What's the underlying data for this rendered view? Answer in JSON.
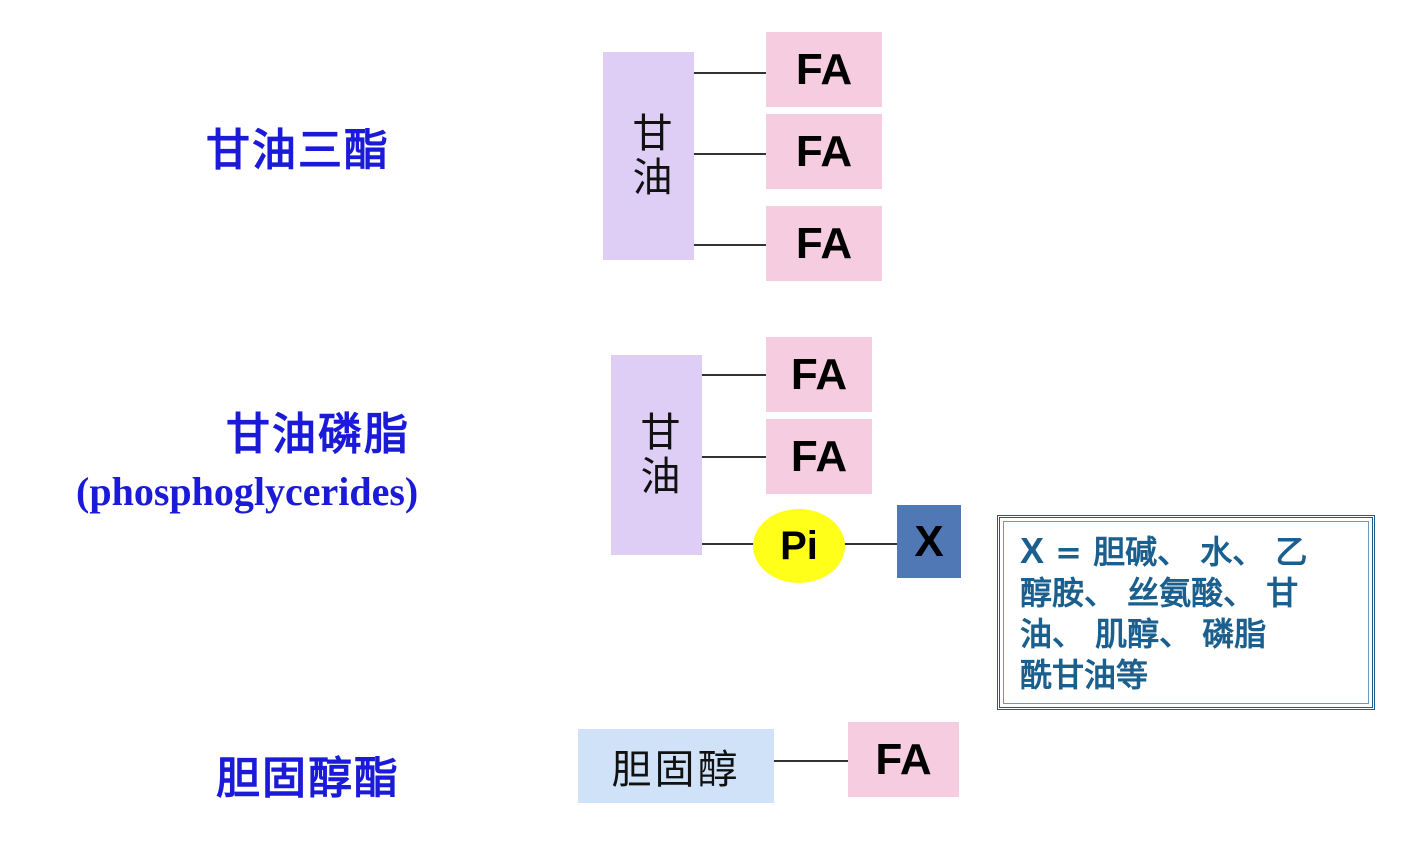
{
  "triglyceride": {
    "title": "甘油三酯",
    "backbone": "甘油",
    "chains": [
      "FA",
      "FA",
      "FA"
    ]
  },
  "phosphoglyceride": {
    "title": "甘油磷脂",
    "subtitle": "(phosphoglycerides)",
    "backbone": "甘油",
    "chains": [
      "FA",
      "FA"
    ],
    "phosphate": "Pi",
    "head": "X"
  },
  "note": {
    "lead": "X",
    "lines": [
      "= 胆碱、 水、 乙",
      "醇胺、 丝氨酸、 甘",
      "油、  肌醇、 磷脂",
      "酰甘油等"
    ]
  },
  "cholesteryl_ester": {
    "title": "胆固醇酯",
    "backbone": "胆固醇",
    "chain": "FA"
  },
  "colors": {
    "title": "#1a1ad8",
    "glycerol": "#decdf5",
    "fatty_acid": "#f6cde0",
    "phosphate": "#ffff1a",
    "head_group": "#4f78b4",
    "cholesterol": "#cfe2f8",
    "note_text": "#1a5f8e"
  }
}
